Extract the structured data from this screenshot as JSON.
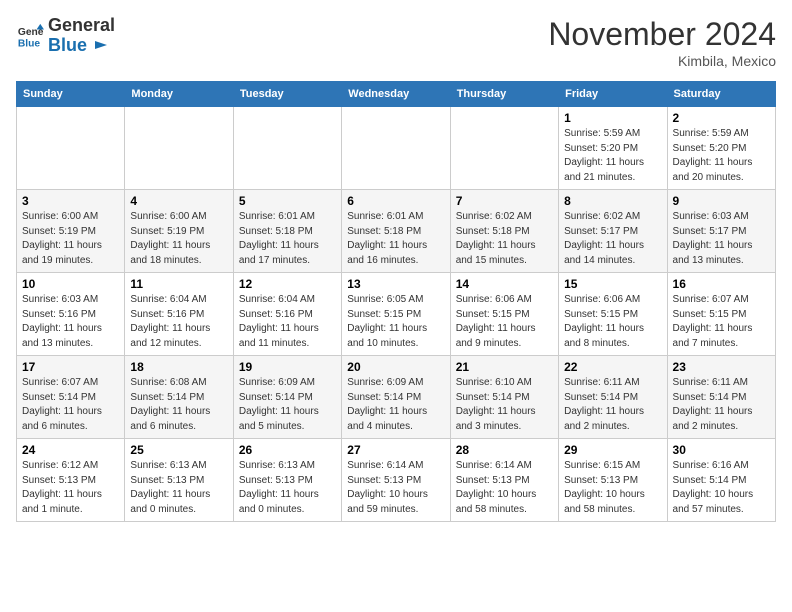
{
  "header": {
    "logo_general": "General",
    "logo_blue": "Blue",
    "month_title": "November 2024",
    "location": "Kimbila, Mexico"
  },
  "days_of_week": [
    "Sunday",
    "Monday",
    "Tuesday",
    "Wednesday",
    "Thursday",
    "Friday",
    "Saturday"
  ],
  "weeks": [
    [
      {
        "day": "",
        "info": ""
      },
      {
        "day": "",
        "info": ""
      },
      {
        "day": "",
        "info": ""
      },
      {
        "day": "",
        "info": ""
      },
      {
        "day": "",
        "info": ""
      },
      {
        "day": "1",
        "info": "Sunrise: 5:59 AM\nSunset: 5:20 PM\nDaylight: 11 hours and 21 minutes."
      },
      {
        "day": "2",
        "info": "Sunrise: 5:59 AM\nSunset: 5:20 PM\nDaylight: 11 hours and 20 minutes."
      }
    ],
    [
      {
        "day": "3",
        "info": "Sunrise: 6:00 AM\nSunset: 5:19 PM\nDaylight: 11 hours and 19 minutes."
      },
      {
        "day": "4",
        "info": "Sunrise: 6:00 AM\nSunset: 5:19 PM\nDaylight: 11 hours and 18 minutes."
      },
      {
        "day": "5",
        "info": "Sunrise: 6:01 AM\nSunset: 5:18 PM\nDaylight: 11 hours and 17 minutes."
      },
      {
        "day": "6",
        "info": "Sunrise: 6:01 AM\nSunset: 5:18 PM\nDaylight: 11 hours and 16 minutes."
      },
      {
        "day": "7",
        "info": "Sunrise: 6:02 AM\nSunset: 5:18 PM\nDaylight: 11 hours and 15 minutes."
      },
      {
        "day": "8",
        "info": "Sunrise: 6:02 AM\nSunset: 5:17 PM\nDaylight: 11 hours and 14 minutes."
      },
      {
        "day": "9",
        "info": "Sunrise: 6:03 AM\nSunset: 5:17 PM\nDaylight: 11 hours and 13 minutes."
      }
    ],
    [
      {
        "day": "10",
        "info": "Sunrise: 6:03 AM\nSunset: 5:16 PM\nDaylight: 11 hours and 13 minutes."
      },
      {
        "day": "11",
        "info": "Sunrise: 6:04 AM\nSunset: 5:16 PM\nDaylight: 11 hours and 12 minutes."
      },
      {
        "day": "12",
        "info": "Sunrise: 6:04 AM\nSunset: 5:16 PM\nDaylight: 11 hours and 11 minutes."
      },
      {
        "day": "13",
        "info": "Sunrise: 6:05 AM\nSunset: 5:15 PM\nDaylight: 11 hours and 10 minutes."
      },
      {
        "day": "14",
        "info": "Sunrise: 6:06 AM\nSunset: 5:15 PM\nDaylight: 11 hours and 9 minutes."
      },
      {
        "day": "15",
        "info": "Sunrise: 6:06 AM\nSunset: 5:15 PM\nDaylight: 11 hours and 8 minutes."
      },
      {
        "day": "16",
        "info": "Sunrise: 6:07 AM\nSunset: 5:15 PM\nDaylight: 11 hours and 7 minutes."
      }
    ],
    [
      {
        "day": "17",
        "info": "Sunrise: 6:07 AM\nSunset: 5:14 PM\nDaylight: 11 hours and 6 minutes."
      },
      {
        "day": "18",
        "info": "Sunrise: 6:08 AM\nSunset: 5:14 PM\nDaylight: 11 hours and 6 minutes."
      },
      {
        "day": "19",
        "info": "Sunrise: 6:09 AM\nSunset: 5:14 PM\nDaylight: 11 hours and 5 minutes."
      },
      {
        "day": "20",
        "info": "Sunrise: 6:09 AM\nSunset: 5:14 PM\nDaylight: 11 hours and 4 minutes."
      },
      {
        "day": "21",
        "info": "Sunrise: 6:10 AM\nSunset: 5:14 PM\nDaylight: 11 hours and 3 minutes."
      },
      {
        "day": "22",
        "info": "Sunrise: 6:11 AM\nSunset: 5:14 PM\nDaylight: 11 hours and 2 minutes."
      },
      {
        "day": "23",
        "info": "Sunrise: 6:11 AM\nSunset: 5:14 PM\nDaylight: 11 hours and 2 minutes."
      }
    ],
    [
      {
        "day": "24",
        "info": "Sunrise: 6:12 AM\nSunset: 5:13 PM\nDaylight: 11 hours and 1 minute."
      },
      {
        "day": "25",
        "info": "Sunrise: 6:13 AM\nSunset: 5:13 PM\nDaylight: 11 hours and 0 minutes."
      },
      {
        "day": "26",
        "info": "Sunrise: 6:13 AM\nSunset: 5:13 PM\nDaylight: 11 hours and 0 minutes."
      },
      {
        "day": "27",
        "info": "Sunrise: 6:14 AM\nSunset: 5:13 PM\nDaylight: 10 hours and 59 minutes."
      },
      {
        "day": "28",
        "info": "Sunrise: 6:14 AM\nSunset: 5:13 PM\nDaylight: 10 hours and 58 minutes."
      },
      {
        "day": "29",
        "info": "Sunrise: 6:15 AM\nSunset: 5:13 PM\nDaylight: 10 hours and 58 minutes."
      },
      {
        "day": "30",
        "info": "Sunrise: 6:16 AM\nSunset: 5:14 PM\nDaylight: 10 hours and 57 minutes."
      }
    ]
  ]
}
